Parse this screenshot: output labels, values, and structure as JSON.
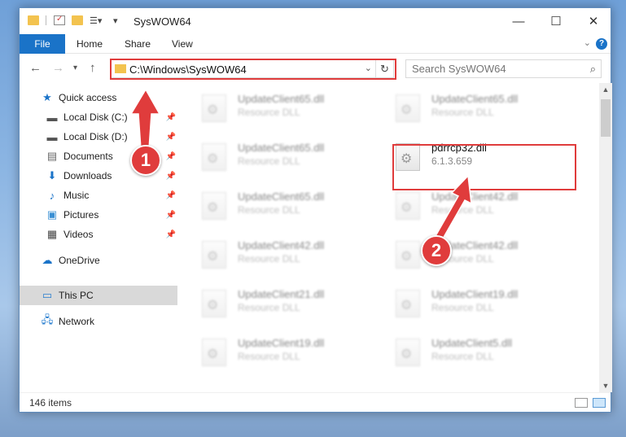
{
  "window": {
    "title": "SysWOW64"
  },
  "ribbon": {
    "tabs": [
      "File",
      "Home",
      "Share",
      "View"
    ],
    "help": "?"
  },
  "address": {
    "path": "C:\\Windows\\SysWOW64"
  },
  "search": {
    "placeholder": "Search SysWOW64"
  },
  "nav": {
    "items": [
      {
        "label": "Quick access",
        "icon": "star-icon"
      },
      {
        "label": "Local Disk (C:)",
        "icon": "drive-icon"
      },
      {
        "label": "Local Disk (D:)",
        "icon": "drive-icon"
      },
      {
        "label": "Documents",
        "icon": "documents-icon"
      },
      {
        "label": "Downloads",
        "icon": "download-icon"
      },
      {
        "label": "Music",
        "icon": "music-icon"
      },
      {
        "label": "Pictures",
        "icon": "pictures-icon"
      },
      {
        "label": "Videos",
        "icon": "videos-icon"
      },
      {
        "label": "OneDrive",
        "icon": "cloud-icon"
      },
      {
        "label": "This PC",
        "icon": "computer-icon"
      },
      {
        "label": "Network",
        "icon": "network-icon"
      }
    ]
  },
  "files": [
    {
      "name": "UpdateClient65.dll",
      "sub": "Resource DLL"
    },
    {
      "name": "UpdateClient65.dll",
      "sub": "Resource DLL"
    },
    {
      "name": "UpdateClient65.dll",
      "sub": "Resource DLL"
    },
    {
      "name": "pdrrcp32.dll",
      "sub": "6.1.3.659"
    },
    {
      "name": "UpdateClient65.dll",
      "sub": "Resource DLL"
    },
    {
      "name": "UpdateClient42.dll",
      "sub": "Resource DLL"
    },
    {
      "name": "UpdateClient42.dll",
      "sub": "Resource DLL"
    },
    {
      "name": "UpdateClient42.dll",
      "sub": "Resource DLL"
    },
    {
      "name": "UpdateClient21.dll",
      "sub": "Resource DLL"
    },
    {
      "name": "UpdateClient19.dll",
      "sub": "Resource DLL"
    },
    {
      "name": "UpdateClient19.dll",
      "sub": "Resource DLL"
    },
    {
      "name": "UpdateClient5.dll",
      "sub": "Resource DLL"
    }
  ],
  "status": {
    "count": "146 items"
  },
  "annotations": {
    "step1": "1",
    "step2": "2",
    "color": "#e03c3c"
  }
}
